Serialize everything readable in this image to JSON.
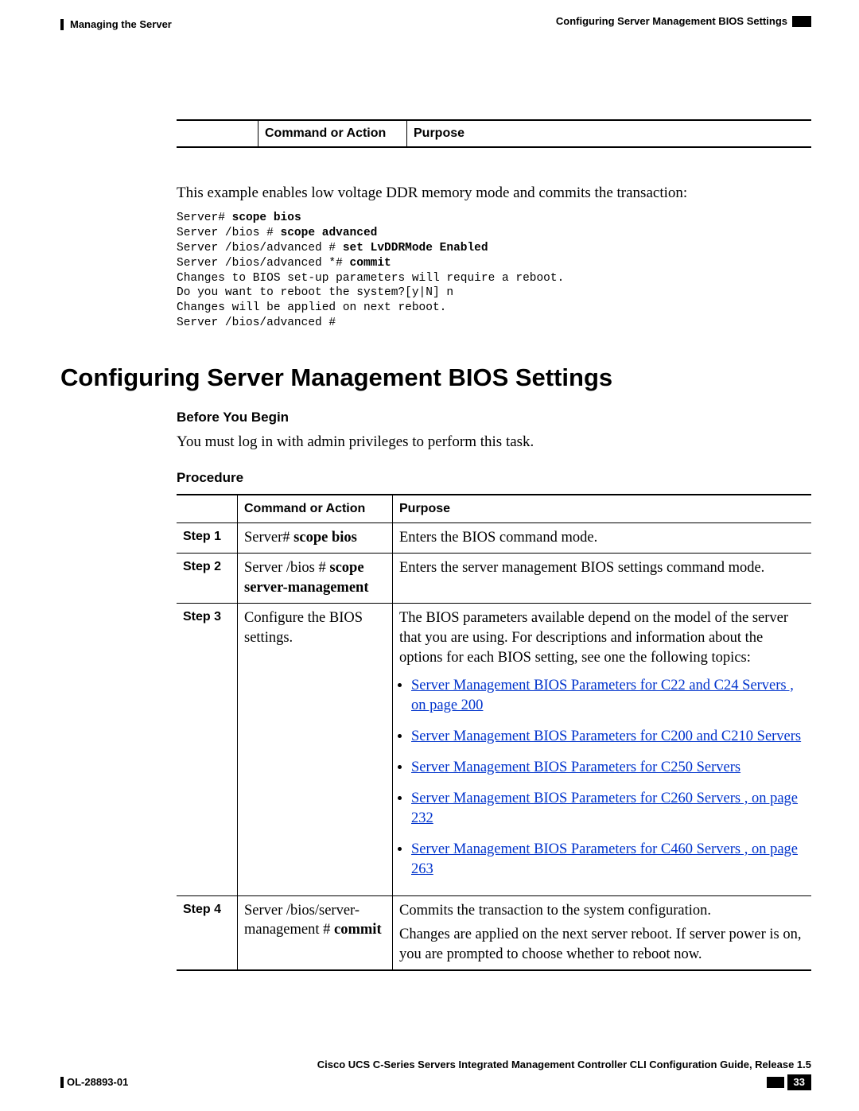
{
  "header": {
    "left": "Managing the Server",
    "right_section": "Configuring Server Management BIOS Settings"
  },
  "top_table": {
    "col1": "Command or Action",
    "col2": "Purpose",
    "blank": ""
  },
  "example_intro": "This example enables low voltage DDR memory mode and commits the transaction:",
  "code": {
    "l1a": "Server# ",
    "l1b": "scope bios",
    "l2a": "Server /bios # ",
    "l2b": "scope advanced",
    "l3a": "Server /bios/advanced # ",
    "l3b": "set LvDDRMode Enabled",
    "l4a": "Server /bios/advanced *# ",
    "l4b": "commit",
    "l5": "Changes to BIOS set-up parameters will require a reboot.",
    "l6": "Do you want to reboot the system?[y|N] n",
    "l7": "Changes will be applied on next reboot.",
    "l8": "Server /bios/advanced #"
  },
  "section_title": "Configuring Server Management BIOS Settings",
  "before_heading": "Before You Begin",
  "before_text": "You must log in with admin privileges to perform this task.",
  "procedure_heading": "Procedure",
  "proc_hdr": {
    "blank": "",
    "cmd": "Command or Action",
    "purpose": "Purpose"
  },
  "steps": {
    "s1": {
      "label": "Step 1",
      "cmd_pre": "Server# ",
      "cmd_bold": "scope bios",
      "purpose": "Enters the BIOS command mode."
    },
    "s2": {
      "label": "Step 2",
      "cmd_pre": "Server /bios # ",
      "cmd_bold": "scope server-management",
      "purpose": "Enters the server management BIOS settings command mode."
    },
    "s3": {
      "label": "Step 3",
      "cmd": "Configure the BIOS settings.",
      "purpose_intro": "The BIOS parameters available depend on the model of the server that you are using. For descriptions and information about the options for each BIOS setting, see one the following topics:",
      "links": {
        "a": "Server Management BIOS Parameters for C22 and C24 Servers ,  on page 200",
        "b": "Server Management BIOS Parameters for C200 and C210 Servers",
        "c": "Server Management BIOS Parameters for C250 Servers",
        "d": "Server Management BIOS Parameters for C260 Servers ,  on page 232",
        "e": "Server Management BIOS Parameters for C460 Servers ,  on page 263"
      }
    },
    "s4": {
      "label": "Step 4",
      "cmd_pre": "Server /bios/server-management # ",
      "cmd_bold": "commit",
      "purpose1": "Commits the transaction to the system configuration.",
      "purpose2": "Changes are applied on the next server reboot. If server power is on, you are prompted to choose whether to reboot now."
    }
  },
  "footer": {
    "guide": "Cisco UCS C-Series Servers Integrated Management Controller CLI Configuration Guide, Release 1.5",
    "docid": "OL-28893-01",
    "page": "33"
  }
}
